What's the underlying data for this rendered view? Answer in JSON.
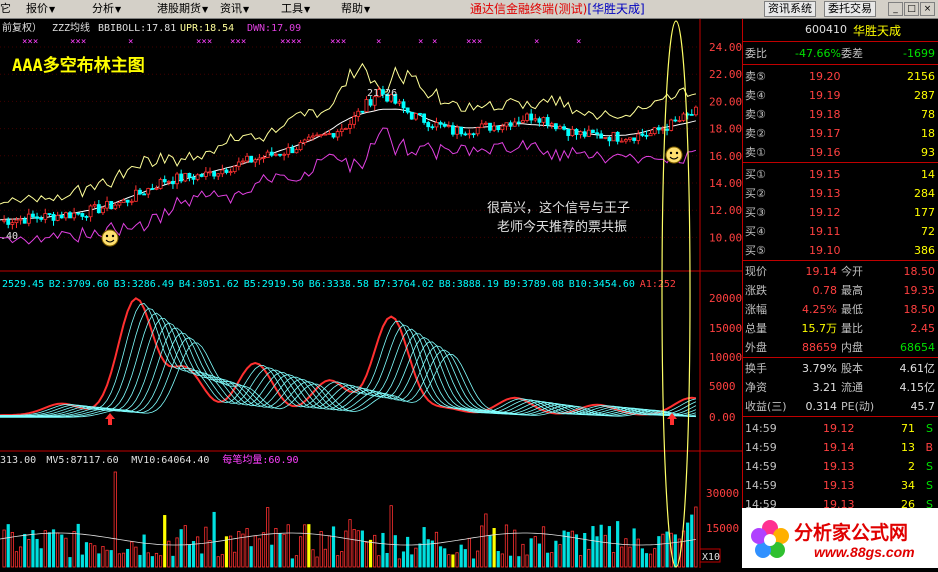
{
  "menubar": {
    "items": [
      "它",
      "报价",
      "分析",
      "港股期货",
      "资讯",
      "工具",
      "帮助"
    ],
    "title_main": "通达信金融终端(测试)",
    "title_broker": "[华胜天成]",
    "btn_info": "资讯系统",
    "btn_trade": "委托交易",
    "win_min": "_",
    "win_max": "□",
    "win_close": "×"
  },
  "chart_top": {
    "caption_prefix": "前复权）",
    "indicator": "ZZZ均线",
    "boll": "BBIBOLL:17.81",
    "upr": "UPR:18.54",
    "dwn": "DWN:17.09",
    "banner": "AAA多空布林主图",
    "peak_label": "21.26",
    "left_label": ".40",
    "annotation_line1": "很高兴，这个信号与王子",
    "annotation_line2": "老师今天推荐的票共振",
    "marks": [
      "×××",
      "×××",
      "×",
      "×××",
      "×××",
      "××××",
      "×××",
      "×",
      "×",
      "×",
      "×××",
      "×",
      "×"
    ],
    "y_labels": [
      "24.00",
      "22.00",
      "20.00",
      "18.00",
      "16.00",
      "14.00",
      "12.00",
      "10.00"
    ],
    "y_values": [
      24,
      22,
      20,
      18,
      16,
      14,
      12,
      10
    ]
  },
  "chart_mid": {
    "legend": [
      {
        "text": "2529.45",
        "color": "#00ffff"
      },
      {
        "text": "B2:3709.60",
        "color": "#00ffff"
      },
      {
        "text": "B3:3286.49",
        "color": "#00ffff"
      },
      {
        "text": "B4:3051.62",
        "color": "#00ffff"
      },
      {
        "text": "B5:2919.50",
        "color": "#00ffff"
      },
      {
        "text": "B6:3338.58",
        "color": "#00ffff"
      },
      {
        "text": "B7:3764.02",
        "color": "#00ffff"
      },
      {
        "text": "B8:3888.19",
        "color": "#00ffff"
      },
      {
        "text": "B9:3789.08",
        "color": "#00ffff"
      },
      {
        "text": "B10:3454.60",
        "color": "#00ffff"
      },
      {
        "text": "A1:252",
        "color": "#ff4040"
      }
    ],
    "y_labels": [
      "20000",
      "15000",
      "10000",
      "5000",
      "0.00"
    ]
  },
  "chart_vol": {
    "legend": [
      {
        "text": "313.00",
        "color": "#e0e0e0"
      },
      {
        "text": "MV5:87117.60",
        "color": "#e0e0e0"
      },
      {
        "text": "MV10:64064.40",
        "color": "#e0e0e0"
      },
      {
        "text": "每笔均量:60.90",
        "color": "#ff40ff"
      }
    ],
    "y_labels": [
      "30000",
      "15000"
    ],
    "corner": "X10"
  },
  "quote": {
    "code": "600410",
    "name": "华胜天成",
    "weibi_label": "委比",
    "weibi": "-47.66%",
    "weicha_label": "委差",
    "weicha": "-1699",
    "asks": [
      {
        "label": "卖⑤",
        "price": "19.20",
        "vol": "2156"
      },
      {
        "label": "卖④",
        "price": "19.19",
        "vol": "287"
      },
      {
        "label": "卖③",
        "price": "19.18",
        "vol": "78"
      },
      {
        "label": "卖②",
        "price": "19.17",
        "vol": "18"
      },
      {
        "label": "卖①",
        "price": "19.16",
        "vol": "93"
      }
    ],
    "bids": [
      {
        "label": "买①",
        "price": "19.15",
        "vol": "14"
      },
      {
        "label": "买②",
        "price": "19.13",
        "vol": "284"
      },
      {
        "label": "买③",
        "price": "19.12",
        "vol": "177"
      },
      {
        "label": "买④",
        "price": "19.11",
        "vol": "72"
      },
      {
        "label": "买⑤",
        "price": "19.10",
        "vol": "386"
      }
    ],
    "stats": [
      {
        "l1": "现价",
        "v1": "19.14",
        "c1": "red",
        "l2": "今开",
        "v2": "18.50",
        "c2": "red"
      },
      {
        "l1": "涨跌",
        "v1": "0.78",
        "c1": "red",
        "l2": "最高",
        "v2": "19.35",
        "c2": "red"
      },
      {
        "l1": "涨幅",
        "v1": "4.25%",
        "c1": "red",
        "l2": "最低",
        "v2": "18.50",
        "c2": "red"
      },
      {
        "l1": "总量",
        "v1": "15.7万",
        "c1": "yellow",
        "l2": "量比",
        "v2": "2.45",
        "c2": "red"
      },
      {
        "l1": "外盘",
        "v1": "88659",
        "c1": "red",
        "l2": "内盘",
        "v2": "68654",
        "c2": "green"
      }
    ],
    "fin": [
      {
        "l1": "换手",
        "v1": "3.79%",
        "l2": "股本",
        "v2": "4.61亿"
      },
      {
        "l1": "净资",
        "v1": "3.21",
        "l2": "流通",
        "v2": "4.15亿"
      },
      {
        "l1": "收益(三)",
        "v1": "0.314",
        "l2": "PE(动)",
        "v2": "45.7"
      }
    ],
    "ticks": [
      {
        "t": "14:59",
        "p": "19.12",
        "v": "71",
        "d": "S",
        "dc": "green"
      },
      {
        "t": "14:59",
        "p": "19.14",
        "v": "13",
        "d": "B",
        "dc": "red"
      },
      {
        "t": "14:59",
        "p": "19.13",
        "v": "2",
        "d": "S",
        "dc": "green"
      },
      {
        "t": "14:59",
        "p": "19.13",
        "v": "34",
        "d": "S",
        "dc": "green"
      },
      {
        "t": "14:59",
        "p": "19.13",
        "v": "26",
        "d": "S",
        "dc": "green"
      }
    ]
  },
  "watermark": {
    "name": "分析家公式网",
    "url": "www.88gs.com"
  },
  "colors": {
    "up": "#ff3030",
    "down": "#00ffff",
    "upper_band": "#ffff99",
    "lower_band": "#e040e0",
    "mid_band": "#ffffff",
    "frame": "#c00000",
    "ellipse": "#ffff66"
  }
}
